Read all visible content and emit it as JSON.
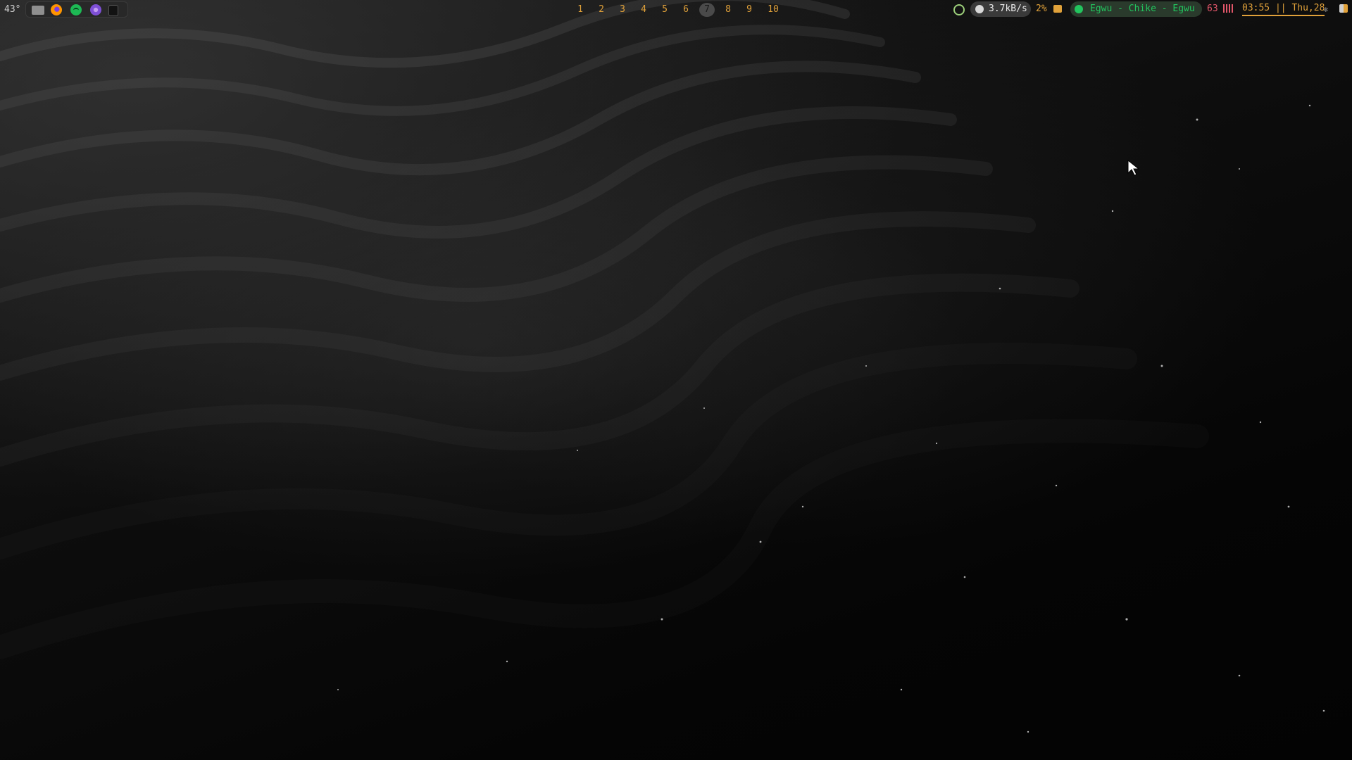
{
  "bar": {
    "temperature": "43°",
    "taskbar_apps": [
      "folder-icon",
      "firefox-icon",
      "spotify-icon",
      "tor-browser-icon",
      "terminal-icon"
    ],
    "workspaces": [
      "1",
      "2",
      "3",
      "4",
      "5",
      "6",
      "7",
      "8",
      "9",
      "10"
    ],
    "active_workspace": "7",
    "network_speed": "3.7kB/s",
    "cpu_usage": "2%",
    "now_playing": "Egwu - Chike - Egwu",
    "volume": "63",
    "clock": "03:55 || Thu,28"
  },
  "colors": {
    "accent": "#e0a13a",
    "spotify_green": "#22c55e",
    "volume_red": "#e2566a"
  }
}
